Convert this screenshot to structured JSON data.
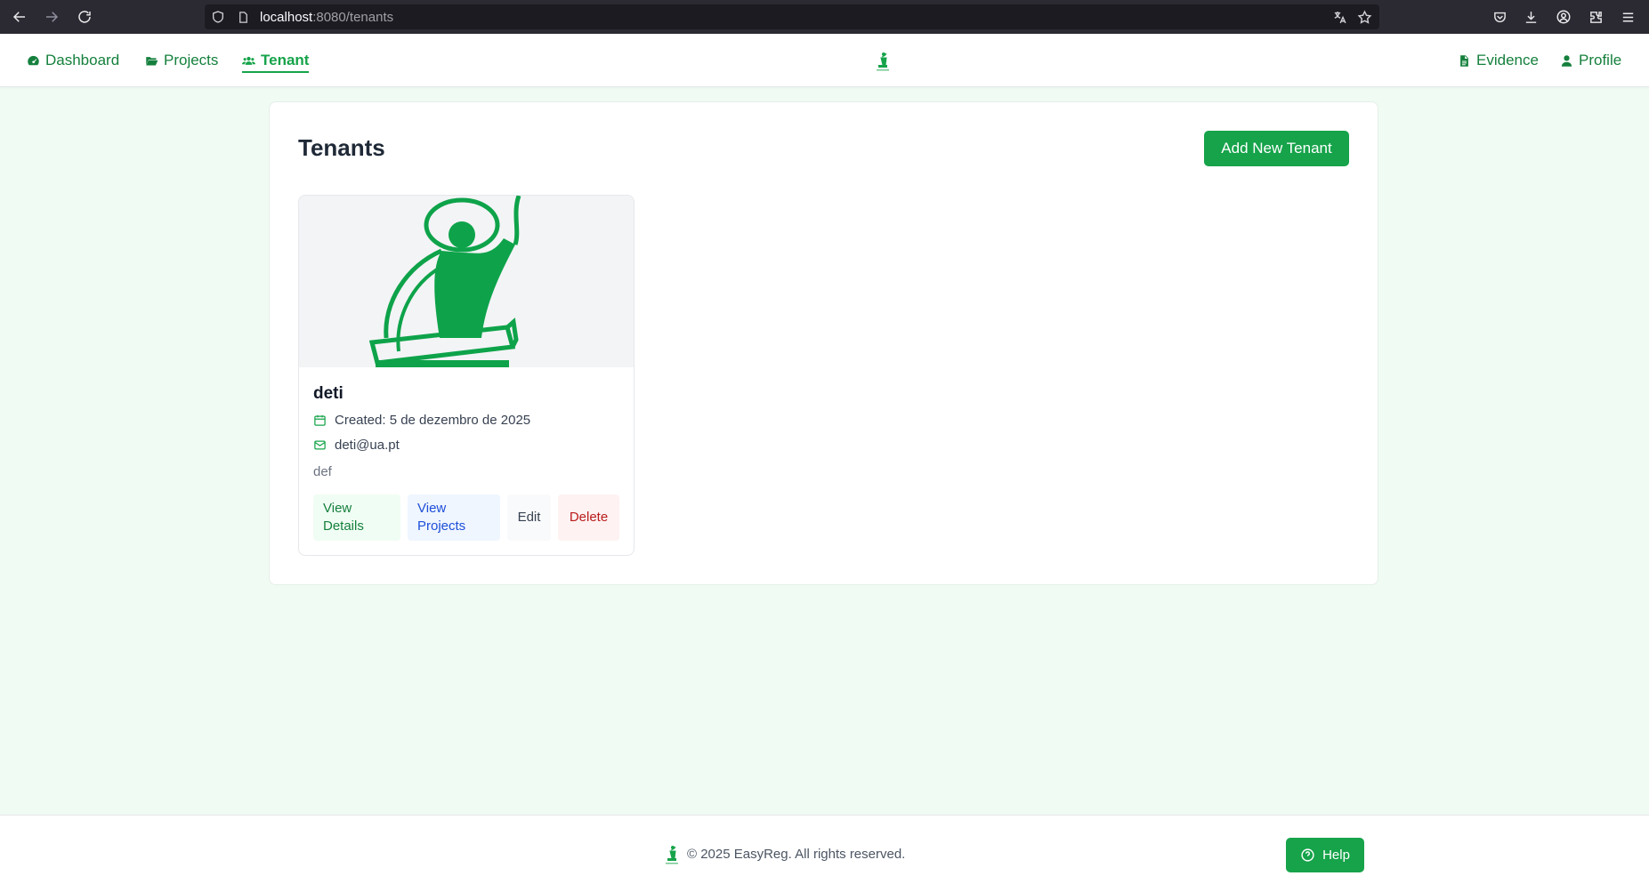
{
  "browser": {
    "url_host": "localhost",
    "url_path": ":8080/tenants",
    "icons": [
      "back-icon",
      "forward-icon",
      "reload-icon",
      "shield-icon",
      "page-icon",
      "translate-icon",
      "star-icon",
      "pocket-icon",
      "download-icon",
      "account-icon",
      "extensions-icon",
      "menu-icon"
    ]
  },
  "nav": {
    "dashboard": "Dashboard",
    "projects": "Projects",
    "tenant": "Tenant",
    "evidence": "Evidence",
    "profile": "Profile"
  },
  "page": {
    "title": "Tenants",
    "add_button": "Add New Tenant"
  },
  "tenants": [
    {
      "name": "deti",
      "created": "Created: 5 de dezembro de 2025",
      "email": "deti@ua.pt",
      "description": "def",
      "actions": {
        "view_details": "View Details",
        "view_projects": "View Projects",
        "edit": "Edit",
        "delete": "Delete"
      }
    }
  ],
  "footer": {
    "copyright": "© 2025 EasyReg. All rights reserved.",
    "help": "Help"
  },
  "colors": {
    "brand_green": "#16a34a",
    "nav_green": "#15803d",
    "delete_red": "#b91c1c",
    "projects_blue": "#1d4ed8"
  }
}
